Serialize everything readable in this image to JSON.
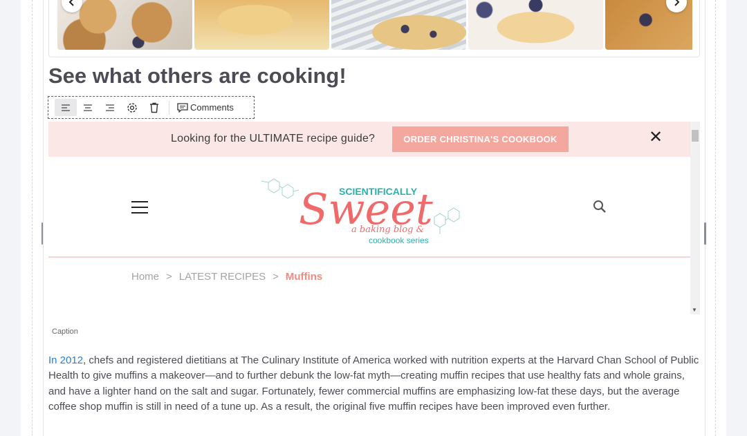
{
  "gallery": {
    "images": [
      {
        "alt": "blueberry-muffins-on-plate"
      },
      {
        "alt": "blueberry-muffin-closeup"
      },
      {
        "alt": "muffins-on-striped-towel"
      },
      {
        "alt": "muffin-with-blueberries"
      },
      {
        "alt": "muffin-tops"
      }
    ],
    "prev_icon": "chevron-left-icon",
    "next_icon": "chevron-right-icon"
  },
  "heading": "See what others are cooking!",
  "toolbar": {
    "align_left_icon": "align-left-icon",
    "align_center_icon": "align-center-icon",
    "align_right_icon": "align-right-icon",
    "settings_icon": "gear-icon",
    "delete_icon": "trash-icon",
    "comments_label": "Comments"
  },
  "embed": {
    "promo_text": "Looking for the ULTIMATE recipe guide?",
    "promo_button": "ORDER CHRISTINA'S COOKBOOK",
    "close_glyph": "✕",
    "logo": {
      "top": "SCIENTIFICALLY",
      "main": "Sweet",
      "tag1": "a baking blog &",
      "tag2": "cookbook series"
    },
    "breadcrumbs": {
      "home": "Home",
      "sep": ">",
      "latest": "LATEST RECIPES",
      "current": "Muffins"
    },
    "colors": {
      "promo_bg": "#fbe8e6",
      "button_bg": "#f3a79e",
      "brand_pink": "#ef6b6b",
      "brand_teal": "#2bb0b0"
    }
  },
  "caption": "Caption",
  "body": {
    "link_text": "In 2012",
    "paragraph": ", chefs and registered dietitians at The Culinary Institute of America worked with nutrition experts at the Harvard Chan School of Public Health to give muffins a makeover—and to further debunk the low-fat myth—creating muffin recipes that use healthy fats and whole grains, and have a lighter hand on the salt and sugar. Fortunately, fewer commercial muffins are emphasizing low-fat these days, but the average coffee shop muffin is still in need of a tune up. As a result, the original five muffin recipes have been improved even further."
  }
}
